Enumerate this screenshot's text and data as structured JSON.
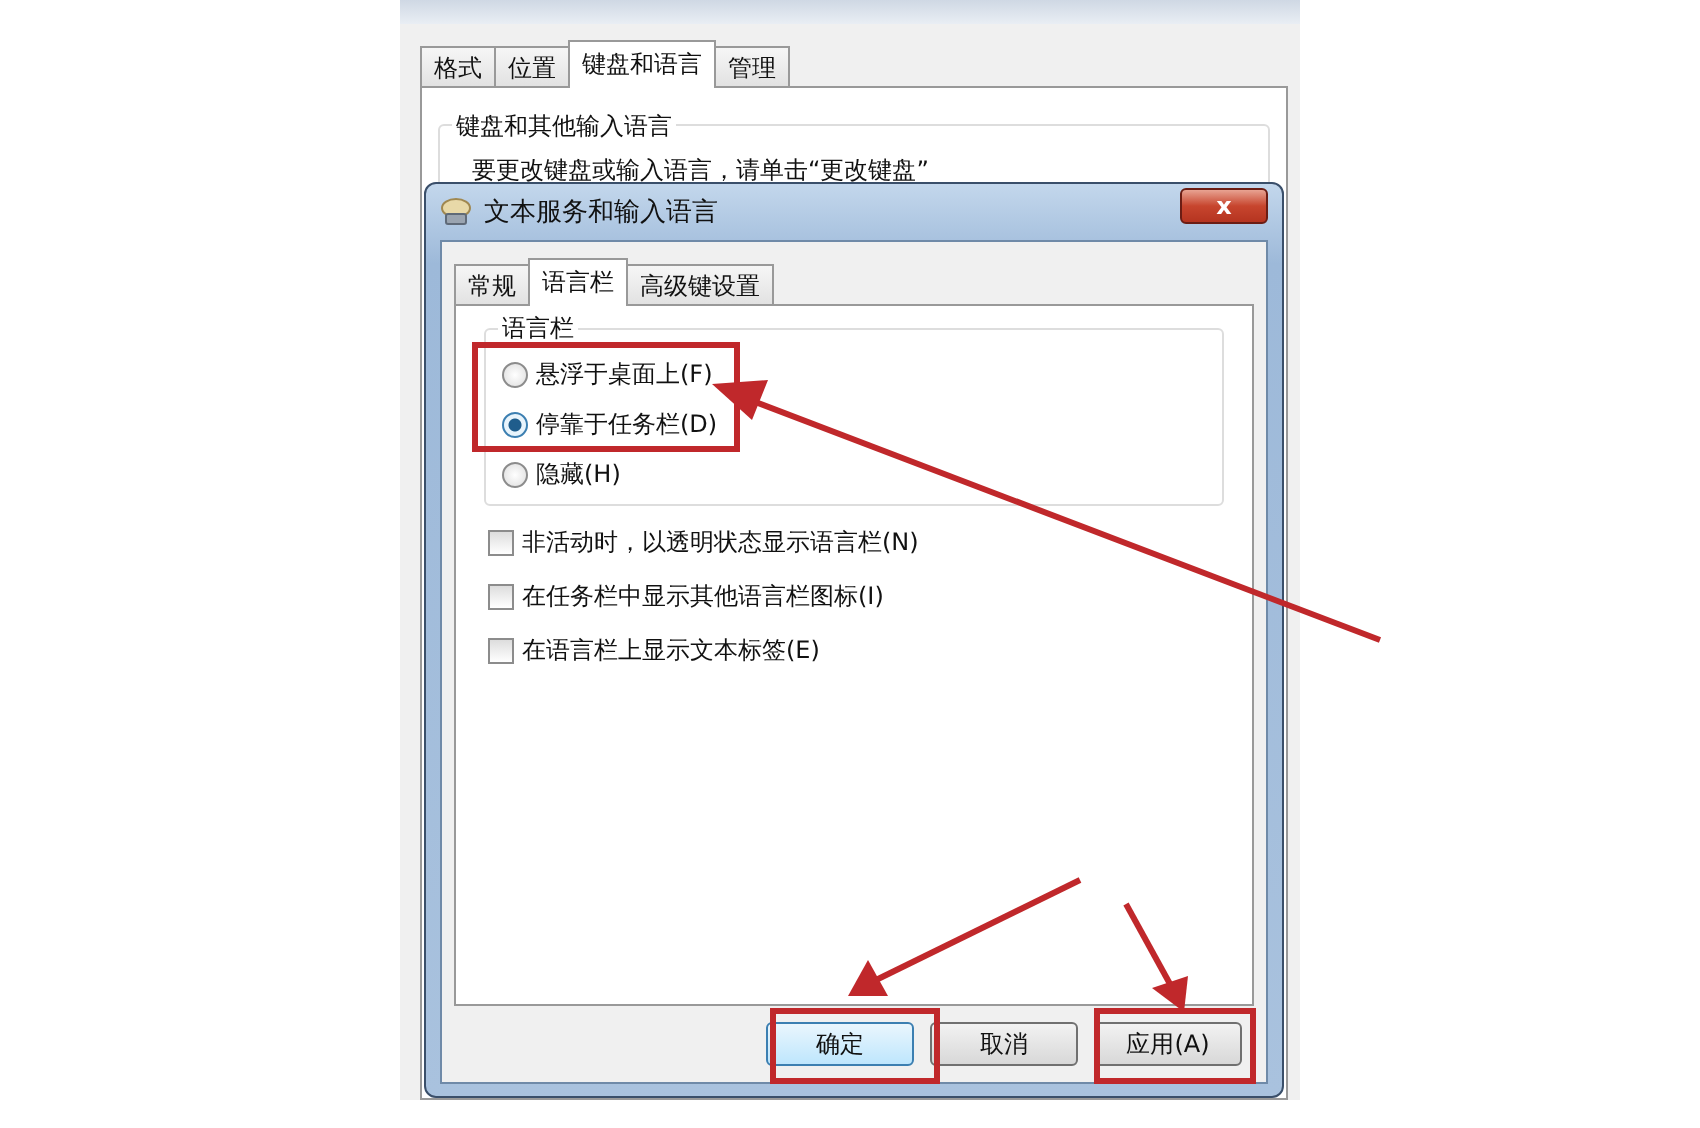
{
  "background_window": {
    "tabs": [
      {
        "label": "格式",
        "selected": false
      },
      {
        "label": "位置",
        "selected": false
      },
      {
        "label": "键盘和语言",
        "selected": true
      },
      {
        "label": "管理",
        "selected": false
      }
    ],
    "group_title": "键盘和其他输入语言",
    "text": "要更改键盘或输入语言，请单击“更改键盘”"
  },
  "dialog": {
    "title": "文本服务和输入语言",
    "close": "x",
    "tabs": [
      {
        "label": "常规",
        "selected": false
      },
      {
        "label": "语言栏",
        "selected": true
      },
      {
        "label": "高级键设置",
        "selected": false
      }
    ],
    "group_title": "语言栏",
    "radios": [
      {
        "label": "悬浮于桌面上(F)",
        "selected": false
      },
      {
        "label": "停靠于任务栏(D)",
        "selected": true
      },
      {
        "label": "隐藏(H)",
        "selected": false
      }
    ],
    "checkboxes": [
      {
        "label": "非活动时，以透明状态显示语言栏(N)",
        "checked": false
      },
      {
        "label": "在任务栏中显示其他语言栏图标(I)",
        "checked": false
      },
      {
        "label": "在语言栏上显示文本标签(E)",
        "checked": false
      }
    ],
    "buttons": [
      {
        "label": "确定",
        "default": true
      },
      {
        "label": "取消",
        "default": false
      },
      {
        "label": "应用(A)",
        "default": false
      }
    ]
  }
}
